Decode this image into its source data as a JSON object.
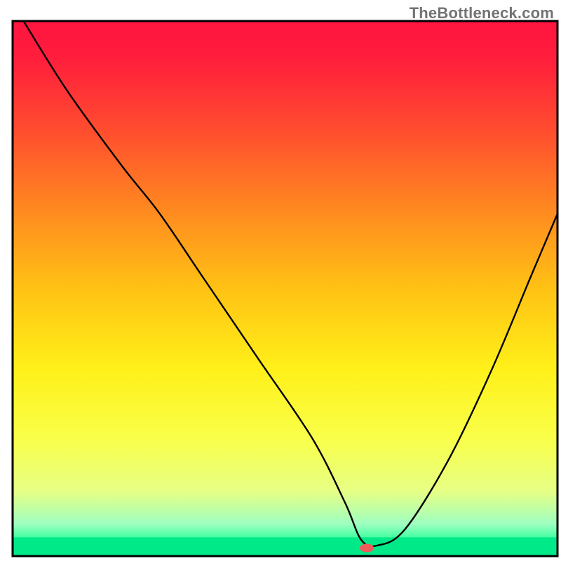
{
  "watermark": "TheBottleneck.com",
  "chart_data": {
    "type": "line",
    "title": "",
    "xlabel": "",
    "ylabel": "",
    "xlim": [
      0,
      100
    ],
    "ylim": [
      0,
      100
    ],
    "background_gradient": {
      "stops": [
        {
          "offset": 0.0,
          "color": "#ff143f"
        },
        {
          "offset": 0.07,
          "color": "#ff1e3c"
        },
        {
          "offset": 0.2,
          "color": "#ff4b2f"
        },
        {
          "offset": 0.35,
          "color": "#ff8820"
        },
        {
          "offset": 0.5,
          "color": "#ffc214"
        },
        {
          "offset": 0.65,
          "color": "#fff019"
        },
        {
          "offset": 0.78,
          "color": "#f9ff49"
        },
        {
          "offset": 0.88,
          "color": "#e6ff86"
        },
        {
          "offset": 0.94,
          "color": "#9effc0"
        },
        {
          "offset": 0.97,
          "color": "#34ff9c"
        },
        {
          "offset": 1.0,
          "color": "#00e989"
        }
      ]
    },
    "green_band": {
      "y0": 96.5,
      "y1": 100,
      "color": "#00e989"
    },
    "marker": {
      "x": 65,
      "y": 98.5,
      "color": "#ef5a5a",
      "rx": 10,
      "ry": 6
    },
    "series": [
      {
        "name": "bottleneck-curve",
        "x": [
          2,
          10,
          20,
          27,
          35,
          45,
          55,
          61,
          64,
          67,
          72,
          80,
          88,
          95,
          100
        ],
        "y": [
          0,
          13,
          27,
          36,
          48,
          63,
          78,
          90,
          97,
          98,
          95,
          82,
          65,
          48,
          36
        ]
      }
    ],
    "frame_color": "#000000"
  }
}
